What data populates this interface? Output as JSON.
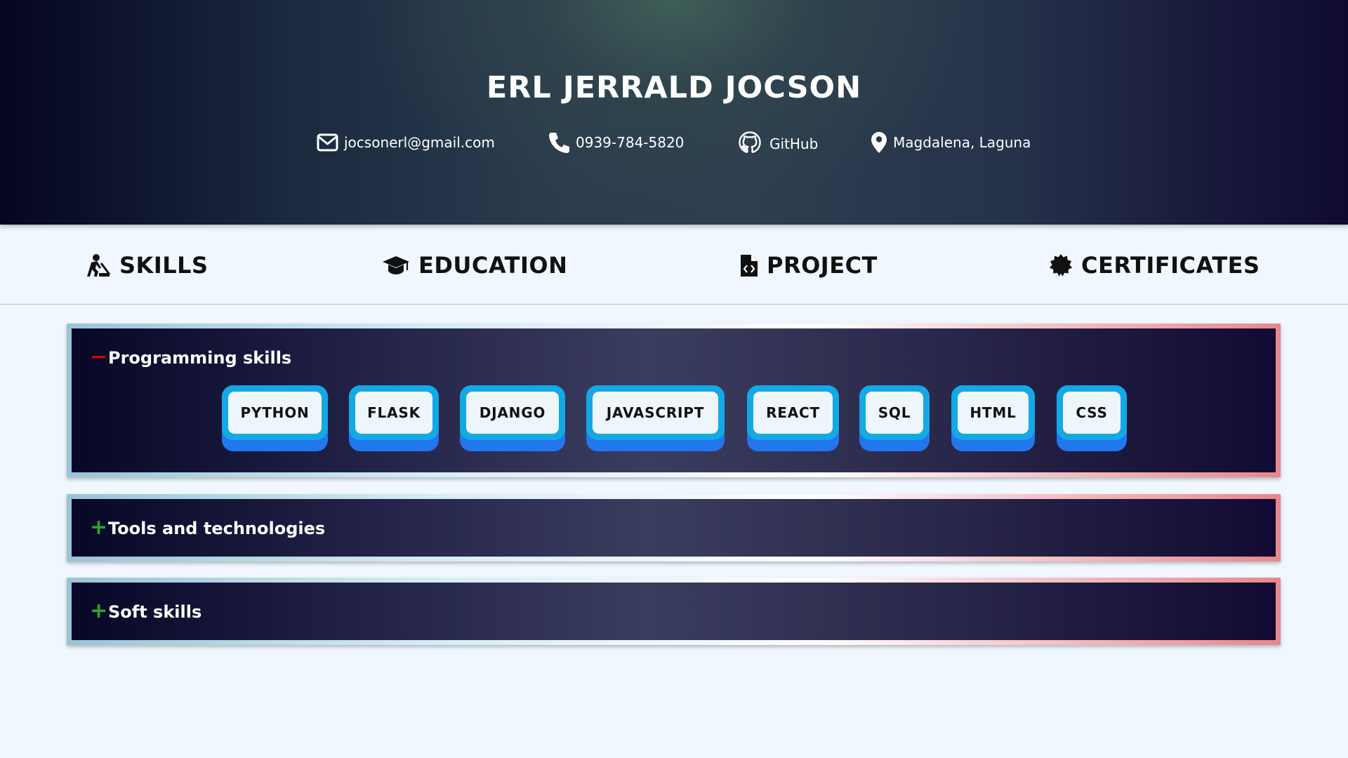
{
  "header": {
    "name": "ERL JERRALD JOCSON",
    "contacts": {
      "email": "jocsonerl@gmail.com",
      "phone": "0939-784-5820",
      "github": "GitHub",
      "location": "Magdalena, Laguna"
    },
    "icons": [
      "envelope-icon",
      "phone-icon",
      "github-icon",
      "location-pin-icon"
    ]
  },
  "nav": {
    "items": [
      {
        "label": "SKILLS",
        "icon": "person-digging-icon"
      },
      {
        "label": "EDUCATION",
        "icon": "graduation-cap-icon"
      },
      {
        "label": "PROJECT",
        "icon": "file-code-icon"
      },
      {
        "label": "CERTIFICATES",
        "icon": "certificate-badge-icon"
      }
    ]
  },
  "sections": [
    {
      "title": "Programming skills",
      "toggle": "−",
      "expanded": true,
      "skills": [
        "PYTHON",
        "FLASK",
        "DJANGO",
        "JAVASCRIPT",
        "REACT",
        "SQL",
        "HTML",
        "CSS"
      ]
    },
    {
      "title": "Tools and technologies",
      "toggle": "+",
      "expanded": false
    },
    {
      "title": "Soft skills",
      "toggle": "+",
      "expanded": false
    }
  ],
  "colors": {
    "page_background": "#f0f7ff",
    "chip_border": "#14a8e4",
    "chip_base": "#2277ee",
    "chip_face": "#eef6fc",
    "toggle_minus": "#e00000",
    "toggle_plus": "#2fa52f"
  }
}
